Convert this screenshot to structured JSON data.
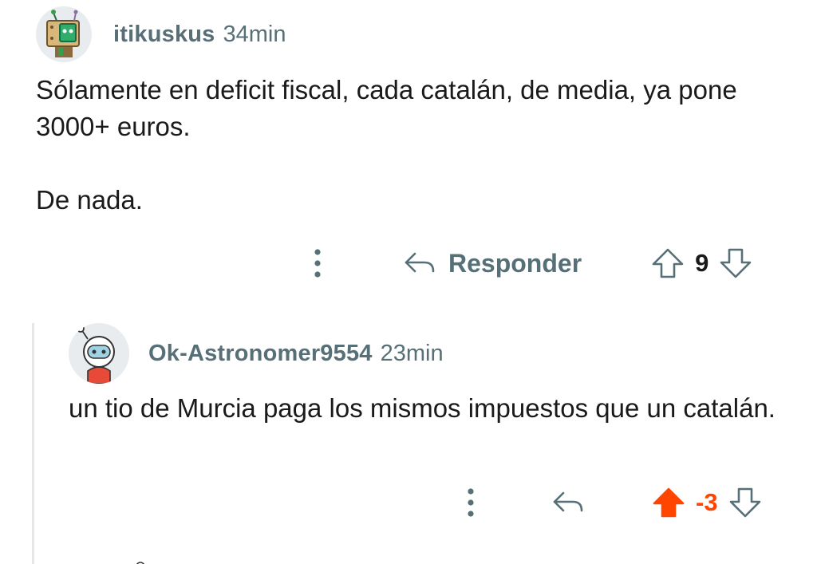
{
  "comments": [
    {
      "username": "itikuskus",
      "time": "34min",
      "paragraphs": [
        "Sólamente en deficit fiscal, cada catalán, de media, ya pone 3000+ euros.",
        "De nada."
      ],
      "actions": {
        "more_icon": "more-vertical-icon",
        "reply_icon": "reply-arrow-icon",
        "reply_label": "Responder",
        "upvote_icon": "upvote-arrow-outline-icon",
        "score": "9",
        "downvote_icon": "downvote-arrow-outline-icon"
      }
    },
    {
      "username": "Ok-Astronomer9554",
      "time": "23min",
      "paragraphs": [
        "un tio de Murcia paga los mismos impuestos que un catalán."
      ],
      "actions": {
        "more_icon": "more-vertical-icon",
        "reply_icon": "reply-arrow-icon",
        "upvote_icon": "upvote-arrow-filled-icon",
        "score": "-3",
        "downvote_icon": "downvote-arrow-outline-icon"
      }
    }
  ],
  "colors": {
    "meta_gray": "#576f76",
    "text": "#1a1a1b",
    "accent_orange": "#ff4500",
    "thread_line": "#e5e7e8"
  }
}
